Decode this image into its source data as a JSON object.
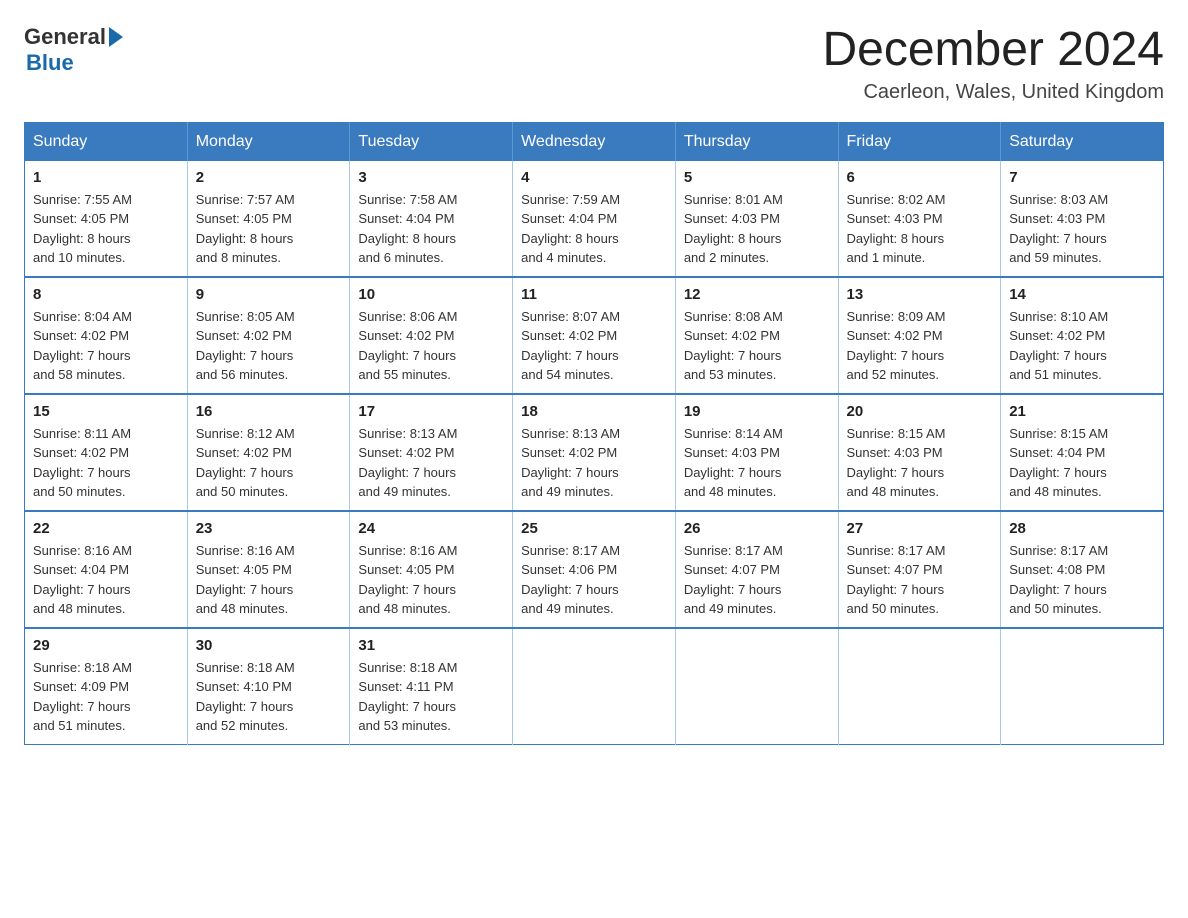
{
  "header": {
    "logo_general": "General",
    "logo_blue": "Blue",
    "month_title": "December 2024",
    "location": "Caerleon, Wales, United Kingdom"
  },
  "days_of_week": [
    "Sunday",
    "Monday",
    "Tuesday",
    "Wednesday",
    "Thursday",
    "Friday",
    "Saturday"
  ],
  "weeks": [
    [
      {
        "day": "1",
        "sunrise": "7:55 AM",
        "sunset": "4:05 PM",
        "daylight": "8 hours and 10 minutes."
      },
      {
        "day": "2",
        "sunrise": "7:57 AM",
        "sunset": "4:05 PM",
        "daylight": "8 hours and 8 minutes."
      },
      {
        "day": "3",
        "sunrise": "7:58 AM",
        "sunset": "4:04 PM",
        "daylight": "8 hours and 6 minutes."
      },
      {
        "day": "4",
        "sunrise": "7:59 AM",
        "sunset": "4:04 PM",
        "daylight": "8 hours and 4 minutes."
      },
      {
        "day": "5",
        "sunrise": "8:01 AM",
        "sunset": "4:03 PM",
        "daylight": "8 hours and 2 minutes."
      },
      {
        "day": "6",
        "sunrise": "8:02 AM",
        "sunset": "4:03 PM",
        "daylight": "8 hours and 1 minute."
      },
      {
        "day": "7",
        "sunrise": "8:03 AM",
        "sunset": "4:03 PM",
        "daylight": "7 hours and 59 minutes."
      }
    ],
    [
      {
        "day": "8",
        "sunrise": "8:04 AM",
        "sunset": "4:02 PM",
        "daylight": "7 hours and 58 minutes."
      },
      {
        "day": "9",
        "sunrise": "8:05 AM",
        "sunset": "4:02 PM",
        "daylight": "7 hours and 56 minutes."
      },
      {
        "day": "10",
        "sunrise": "8:06 AM",
        "sunset": "4:02 PM",
        "daylight": "7 hours and 55 minutes."
      },
      {
        "day": "11",
        "sunrise": "8:07 AM",
        "sunset": "4:02 PM",
        "daylight": "7 hours and 54 minutes."
      },
      {
        "day": "12",
        "sunrise": "8:08 AM",
        "sunset": "4:02 PM",
        "daylight": "7 hours and 53 minutes."
      },
      {
        "day": "13",
        "sunrise": "8:09 AM",
        "sunset": "4:02 PM",
        "daylight": "7 hours and 52 minutes."
      },
      {
        "day": "14",
        "sunrise": "8:10 AM",
        "sunset": "4:02 PM",
        "daylight": "7 hours and 51 minutes."
      }
    ],
    [
      {
        "day": "15",
        "sunrise": "8:11 AM",
        "sunset": "4:02 PM",
        "daylight": "7 hours and 50 minutes."
      },
      {
        "day": "16",
        "sunrise": "8:12 AM",
        "sunset": "4:02 PM",
        "daylight": "7 hours and 50 minutes."
      },
      {
        "day": "17",
        "sunrise": "8:13 AM",
        "sunset": "4:02 PM",
        "daylight": "7 hours and 49 minutes."
      },
      {
        "day": "18",
        "sunrise": "8:13 AM",
        "sunset": "4:02 PM",
        "daylight": "7 hours and 49 minutes."
      },
      {
        "day": "19",
        "sunrise": "8:14 AM",
        "sunset": "4:03 PM",
        "daylight": "7 hours and 48 minutes."
      },
      {
        "day": "20",
        "sunrise": "8:15 AM",
        "sunset": "4:03 PM",
        "daylight": "7 hours and 48 minutes."
      },
      {
        "day": "21",
        "sunrise": "8:15 AM",
        "sunset": "4:04 PM",
        "daylight": "7 hours and 48 minutes."
      }
    ],
    [
      {
        "day": "22",
        "sunrise": "8:16 AM",
        "sunset": "4:04 PM",
        "daylight": "7 hours and 48 minutes."
      },
      {
        "day": "23",
        "sunrise": "8:16 AM",
        "sunset": "4:05 PM",
        "daylight": "7 hours and 48 minutes."
      },
      {
        "day": "24",
        "sunrise": "8:16 AM",
        "sunset": "4:05 PM",
        "daylight": "7 hours and 48 minutes."
      },
      {
        "day": "25",
        "sunrise": "8:17 AM",
        "sunset": "4:06 PM",
        "daylight": "7 hours and 49 minutes."
      },
      {
        "day": "26",
        "sunrise": "8:17 AM",
        "sunset": "4:07 PM",
        "daylight": "7 hours and 49 minutes."
      },
      {
        "day": "27",
        "sunrise": "8:17 AM",
        "sunset": "4:07 PM",
        "daylight": "7 hours and 50 minutes."
      },
      {
        "day": "28",
        "sunrise": "8:17 AM",
        "sunset": "4:08 PM",
        "daylight": "7 hours and 50 minutes."
      }
    ],
    [
      {
        "day": "29",
        "sunrise": "8:18 AM",
        "sunset": "4:09 PM",
        "daylight": "7 hours and 51 minutes."
      },
      {
        "day": "30",
        "sunrise": "8:18 AM",
        "sunset": "4:10 PM",
        "daylight": "7 hours and 52 minutes."
      },
      {
        "day": "31",
        "sunrise": "8:18 AM",
        "sunset": "4:11 PM",
        "daylight": "7 hours and 53 minutes."
      },
      null,
      null,
      null,
      null
    ]
  ],
  "labels": {
    "sunrise": "Sunrise:",
    "sunset": "Sunset:",
    "daylight": "Daylight:"
  }
}
